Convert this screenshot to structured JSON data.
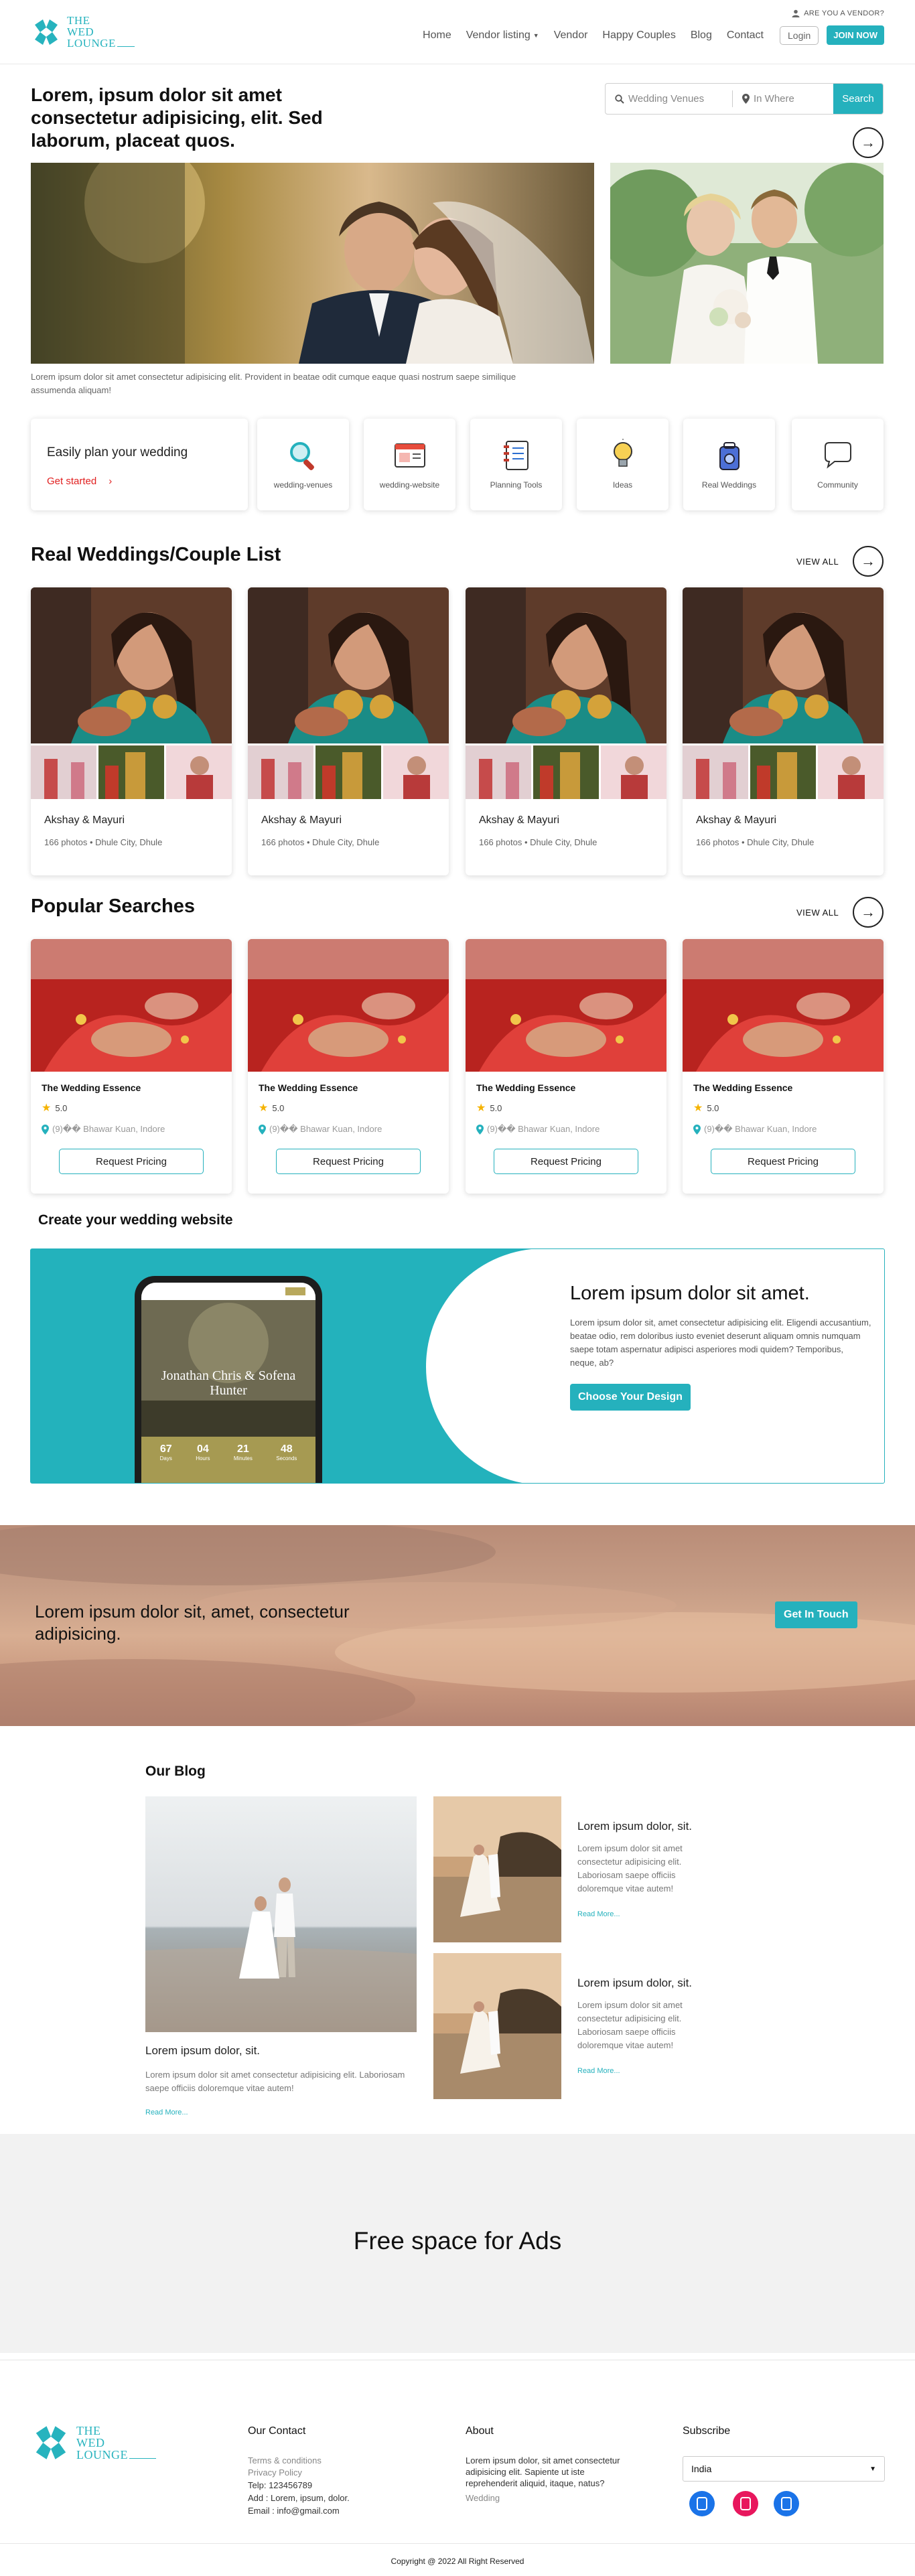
{
  "header": {
    "logo_text": [
      "THE",
      "WED",
      "LOUNGE"
    ],
    "vendor_question": "ARE YOU A VENDOR?",
    "nav": [
      "Home",
      "Vendor listing",
      "Vendor",
      "Happy Couples",
      "Blog",
      "Contact"
    ],
    "login": "Login",
    "join": "JOIN NOW"
  },
  "hero": {
    "title": "Lorem, ipsum dolor sit amet consectetur adipisicing, elit. Sed laborum, placeat quos.",
    "search_venue_placeholder": "Wedding Venues",
    "search_where_placeholder": "In Where",
    "search_button": "Search",
    "caption": "Lorem ipsum dolor sit amet consectetur adipisicing elit. Provident in beatae odit cumque eaque quasi nostrum saepe similique assumenda aliquam!"
  },
  "plan": {
    "title": "Easily plan your wedding",
    "get_started": "Get started",
    "items": [
      {
        "label": "wedding-venues",
        "icon": "magnifier-icon"
      },
      {
        "label": "wedding-website",
        "icon": "browser-window-icon"
      },
      {
        "label": "Planning Tools",
        "icon": "notebook-icon"
      },
      {
        "label": "Ideas",
        "icon": "lightbulb-icon"
      },
      {
        "label": "Real Weddings",
        "icon": "camera-bag-icon"
      },
      {
        "label": "Community",
        "icon": "chat-bubble-icon"
      }
    ]
  },
  "real_weddings": {
    "title": "Real Weddings/Couple List",
    "view_all": "VIEW ALL",
    "cards": [
      {
        "name": "Akshay & Mayuri",
        "meta": "166 photos • Dhule City, Dhule"
      },
      {
        "name": "Akshay & Mayuri",
        "meta": "166 photos • Dhule City, Dhule"
      },
      {
        "name": "Akshay & Mayuri",
        "meta": "166 photos • Dhule City, Dhule"
      },
      {
        "name": "Akshay & Mayuri",
        "meta": "166 photos • Dhule City, Dhule"
      }
    ]
  },
  "popular": {
    "title": "Popular Searches",
    "view_all": "VIEW ALL",
    "cards": [
      {
        "name": "The Wedding Essence",
        "rating": "5.0",
        "location": "(9)�� Bhawar Kuan, Indore",
        "button": "Request Pricing"
      },
      {
        "name": "The Wedding Essence",
        "rating": "5.0",
        "location": "(9)�� Bhawar Kuan, Indore",
        "button": "Request Pricing"
      },
      {
        "name": "The Wedding Essence",
        "rating": "5.0",
        "location": "(9)�� Bhawar Kuan, Indore",
        "button": "Request Pricing"
      },
      {
        "name": "The Wedding Essence",
        "rating": "5.0",
        "location": "(9)�� Bhawar Kuan, Indore",
        "button": "Request Pricing"
      }
    ]
  },
  "website": {
    "section_title": "Create your wedding website",
    "heading": "Lorem ipsum dolor sit amet.",
    "text": "Lorem ipsum dolor sit, amet consectetur adipisicing elit. Eligendi accusantium, beatae odio, rem doloribus iusto eveniet deserunt aliquam omnis numquam saepe totam aspernatur adipisci asperiores modi quidem? Temporibus, neque, ab?",
    "button": "Choose Your Design",
    "phone_names": "Jonathan Chris & Sofena Hunter",
    "countdown": [
      {
        "value": "67",
        "unit": "Days"
      },
      {
        "value": "04",
        "unit": "Hours"
      },
      {
        "value": "21",
        "unit": "Minutes"
      },
      {
        "value": "48",
        "unit": "Seconds"
      }
    ]
  },
  "cta": {
    "text": "Lorem ipsum dolor sit, amet, consectetur adipisicing.",
    "button": "Get In Touch"
  },
  "blog": {
    "title": "Our Blog",
    "big": {
      "heading": "Lorem ipsum dolor, sit.",
      "text": "Lorem ipsum dolor sit amet consectetur adipisicing elit. Laboriosam saepe officiis doloremque vitae autem!",
      "read_more": "Read More..."
    },
    "small": [
      {
        "heading": "Lorem ipsum dolor, sit.",
        "text": "Lorem ipsum dolor sit amet consectetur adipisicing elit. Laboriosam saepe officiis doloremque vitae autem!",
        "read_more": "Read More..."
      },
      {
        "heading": "Lorem ipsum dolor, sit.",
        "text": "Lorem ipsum dolor sit amet consectetur adipisicing elit. Laboriosam saepe officiis doloremque vitae autem!",
        "read_more": "Read More..."
      }
    ]
  },
  "ads": {
    "text": "Free space for Ads"
  },
  "footer": {
    "contact_title": "Our Contact",
    "contact_links": [
      "Terms & conditions",
      "Privacy Policy"
    ],
    "contact_details": [
      "Telp: 123456789",
      "Add : Lorem, ipsum, dolor.",
      "Email : info@gmail.com"
    ],
    "about_title": "About",
    "about_text": "Lorem ipsum dolor, sit amet consectetur adipisicing elit. Sapiente ut iste reprehenderit aliquid, itaque, natus?",
    "about_link": "Wedding",
    "subscribe_title": "Subscribe",
    "country": "India",
    "social": [
      {
        "icon": "instagram-icon",
        "color": "#1a73e8"
      },
      {
        "icon": "instagram-icon",
        "color": "#e8175d"
      },
      {
        "icon": "instagram-icon",
        "color": "#1a73e8"
      }
    ],
    "copyright": "Copyright @ 2022 All Right Reserved"
  },
  "colors": {
    "accent": "#25b1bd",
    "get_started": "#e12020",
    "star": "#f5b301"
  }
}
